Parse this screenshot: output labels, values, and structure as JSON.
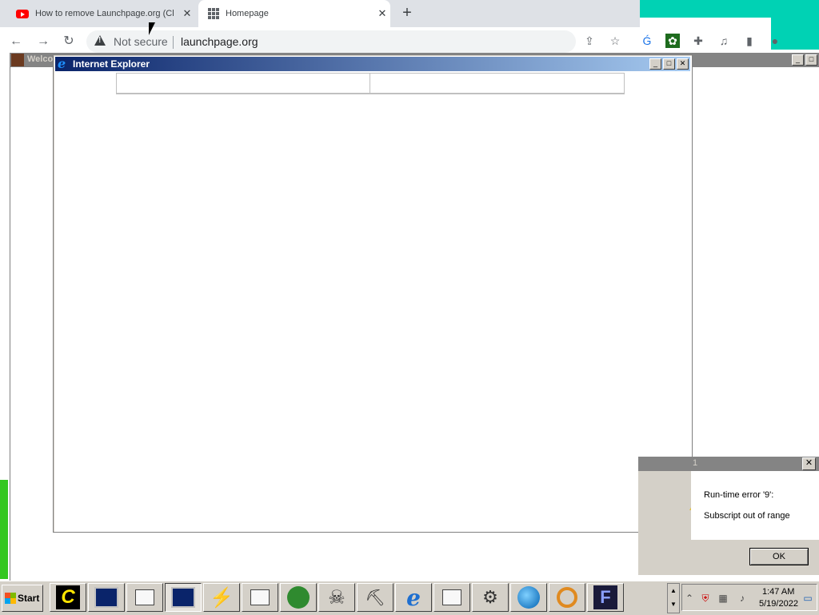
{
  "browser": {
    "tabs": [
      {
        "title": "How to remove Launchpage.org (Cl",
        "icon": "youtube-icon"
      },
      {
        "title": "Homepage",
        "icon": "apps-grid-icon"
      }
    ],
    "new_tab": "+",
    "close_glyph": "✕",
    "security_label": "Not secure",
    "url": "launchpage.org"
  },
  "bg_window": {
    "title": "Welco"
  },
  "ie_window": {
    "title": "Internet Explorer"
  },
  "error_dialog": {
    "title_fragment": "1",
    "line1": "Run-time error '9':",
    "line2": "Subscript out of range",
    "ok_label": "OK"
  },
  "taskbar": {
    "start_label": "Start",
    "clock_time": "1:47 AM",
    "clock_date": "5/19/2022"
  },
  "colors": {
    "accent_teal": "#00d2b4",
    "ie_title_start": "#0a246a",
    "ie_title_end": "#a6caf0"
  }
}
